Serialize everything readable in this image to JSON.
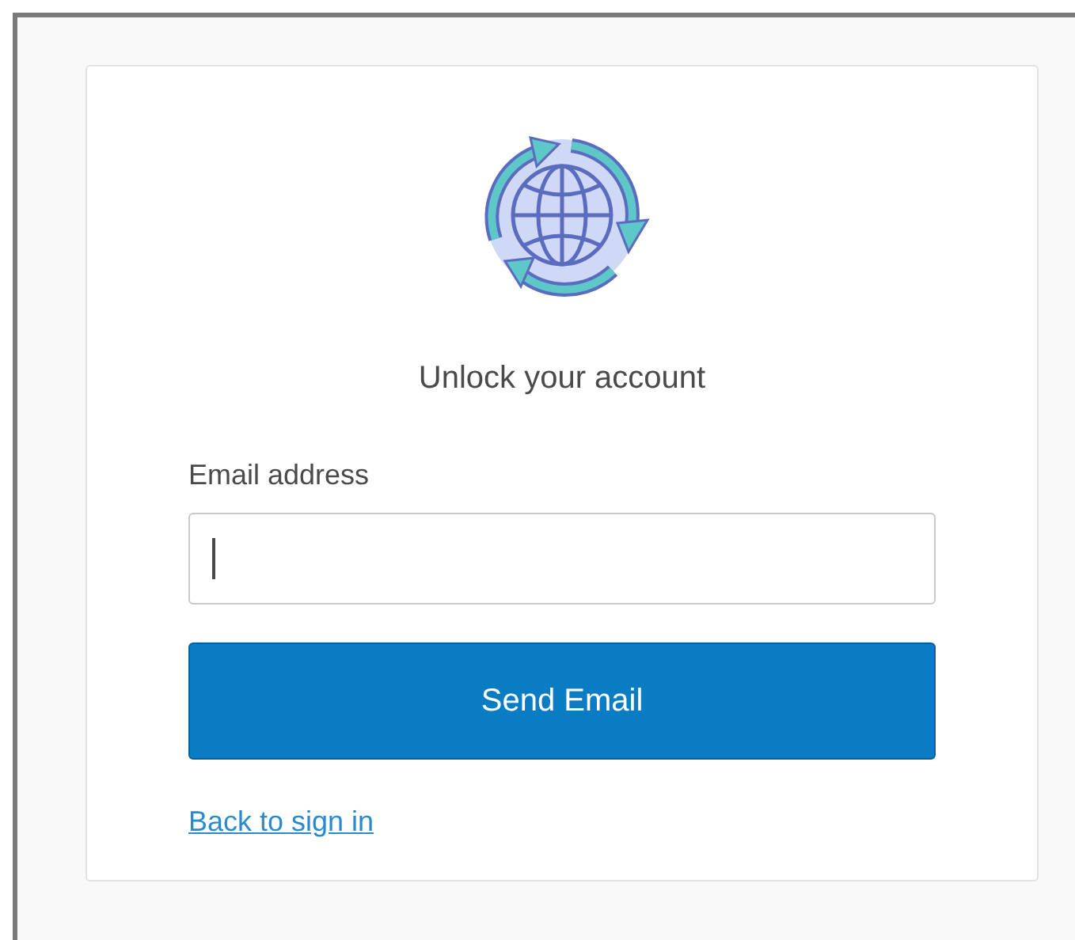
{
  "title": "Unlock your account",
  "email_field": {
    "label": "Email address",
    "focused": true
  },
  "submit_button": {
    "label": "Send Email"
  },
  "back_link": {
    "label": "Back to sign in"
  }
}
